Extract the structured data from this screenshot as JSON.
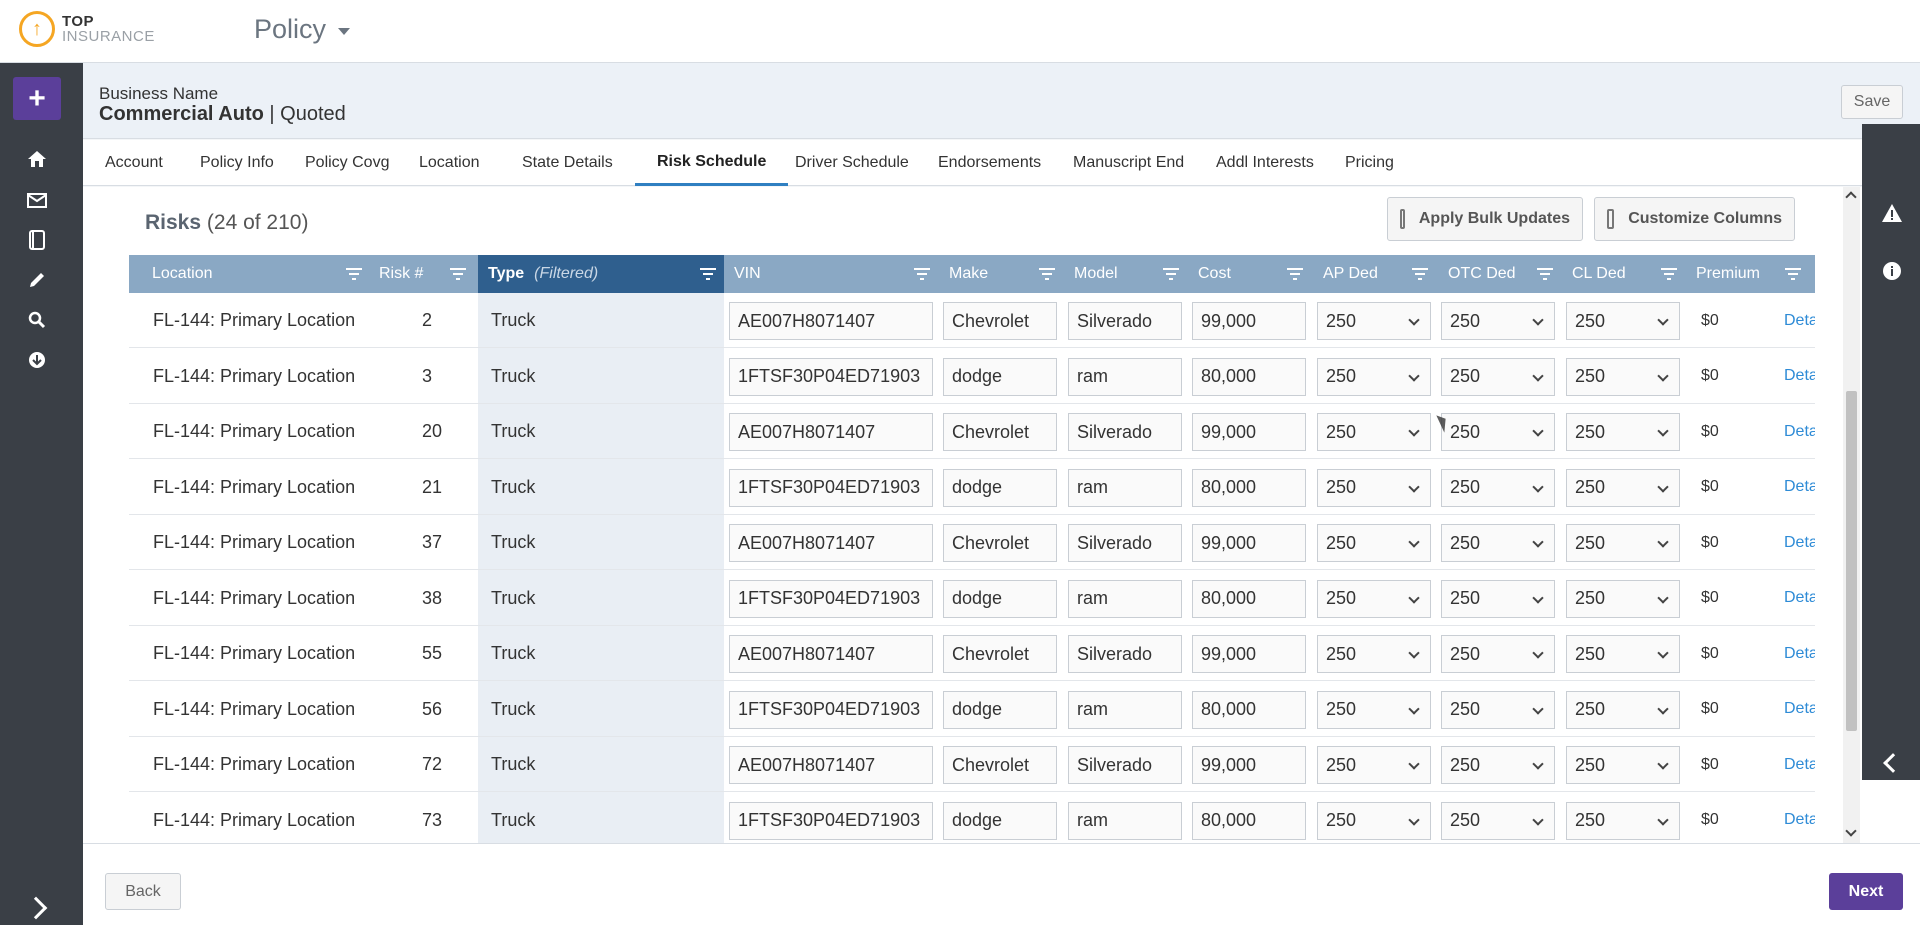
{
  "brand": {
    "top": "TOP",
    "bottom": "INSURANCE"
  },
  "app_menu": {
    "label": "Policy"
  },
  "header": {
    "business_name": "Business Name",
    "product": "Commercial Auto",
    "separator": " | ",
    "status": "Quoted",
    "save_label": "Save"
  },
  "tabs": [
    {
      "label": "Account"
    },
    {
      "label": "Policy Info"
    },
    {
      "label": "Policy Covg"
    },
    {
      "label": "Location"
    },
    {
      "label": "State Details"
    },
    {
      "label": "Risk Schedule",
      "active": true
    },
    {
      "label": "Driver Schedule"
    },
    {
      "label": "Endorsements"
    },
    {
      "label": "Manuscript End"
    },
    {
      "label": "Addl Interests"
    },
    {
      "label": "Pricing"
    }
  ],
  "risks": {
    "title": "Risks",
    "count": "(24 of 210)",
    "apply_bulk_label": "Apply Bulk Updates",
    "customize_label": "Customize Columns"
  },
  "columns": {
    "location": "Location",
    "risk": "Risk #",
    "type": "Type",
    "type_filtered": "(Filtered)",
    "vin": "VIN",
    "make": "Make",
    "model": "Model",
    "cost": "Cost",
    "ap_ded": "AP Ded",
    "otc_ded": "OTC Ded",
    "cl_ded": "CL Ded",
    "premium": "Premium"
  },
  "rows": [
    {
      "location": "FL-144: Primary Location",
      "risk": "2",
      "type": "Truck",
      "vin": "AE007H8071407",
      "make": "Chevrolet",
      "model": "Silverado",
      "cost": "99,000",
      "ap": "250",
      "otc": "250",
      "cl": "250",
      "premium": "$0",
      "detail": "Deta"
    },
    {
      "location": "FL-144: Primary Location",
      "risk": "3",
      "type": "Truck",
      "vin": "1FTSF30P04ED71903",
      "make": "dodge",
      "model": "ram",
      "cost": "80,000",
      "ap": "250",
      "otc": "250",
      "cl": "250",
      "premium": "$0",
      "detail": "Deta"
    },
    {
      "location": "FL-144: Primary Location",
      "risk": "20",
      "type": "Truck",
      "vin": "AE007H8071407",
      "make": "Chevrolet",
      "model": "Silverado",
      "cost": "99,000",
      "ap": "250",
      "otc": "250",
      "cl": "250",
      "premium": "$0",
      "detail": "Deta"
    },
    {
      "location": "FL-144: Primary Location",
      "risk": "21",
      "type": "Truck",
      "vin": "1FTSF30P04ED71903",
      "make": "dodge",
      "model": "ram",
      "cost": "80,000",
      "ap": "250",
      "otc": "250",
      "cl": "250",
      "premium": "$0",
      "detail": "Deta"
    },
    {
      "location": "FL-144: Primary Location",
      "risk": "37",
      "type": "Truck",
      "vin": "AE007H8071407",
      "make": "Chevrolet",
      "model": "Silverado",
      "cost": "99,000",
      "ap": "250",
      "otc": "250",
      "cl": "250",
      "premium": "$0",
      "detail": "Deta"
    },
    {
      "location": "FL-144: Primary Location",
      "risk": "38",
      "type": "Truck",
      "vin": "1FTSF30P04ED71903",
      "make": "dodge",
      "model": "ram",
      "cost": "80,000",
      "ap": "250",
      "otc": "250",
      "cl": "250",
      "premium": "$0",
      "detail": "Deta"
    },
    {
      "location": "FL-144: Primary Location",
      "risk": "55",
      "type": "Truck",
      "vin": "AE007H8071407",
      "make": "Chevrolet",
      "model": "Silverado",
      "cost": "99,000",
      "ap": "250",
      "otc": "250",
      "cl": "250",
      "premium": "$0",
      "detail": "Deta"
    },
    {
      "location": "FL-144: Primary Location",
      "risk": "56",
      "type": "Truck",
      "vin": "1FTSF30P04ED71903",
      "make": "dodge",
      "model": "ram",
      "cost": "80,000",
      "ap": "250",
      "otc": "250",
      "cl": "250",
      "premium": "$0",
      "detail": "Deta"
    },
    {
      "location": "FL-144: Primary Location",
      "risk": "72",
      "type": "Truck",
      "vin": "AE007H8071407",
      "make": "Chevrolet",
      "model": "Silverado",
      "cost": "99,000",
      "ap": "250",
      "otc": "250",
      "cl": "250",
      "premium": "$0",
      "detail": "Deta"
    },
    {
      "location": "FL-144: Primary Location",
      "risk": "73",
      "type": "Truck",
      "vin": "1FTSF30P04ED71903",
      "make": "dodge",
      "model": "ram",
      "cost": "80,000",
      "ap": "250",
      "otc": "250",
      "cl": "250",
      "premium": "$0",
      "detail": "Deta"
    }
  ],
  "footer": {
    "back_label": "Back",
    "next_label": "Next"
  },
  "colors": {
    "accent": "#5b3f9a",
    "nav_bg": "#3a3f46",
    "grid_header": "#8aa8c4",
    "filtered_header": "#2f5f8e",
    "link": "#2e8bd6",
    "tab_active": "#2f7fc1",
    "logo": "#f5a623"
  },
  "icons": {
    "nav": [
      "home-icon",
      "mail-icon",
      "document-icon",
      "pencil-icon",
      "search-icon",
      "download-icon"
    ],
    "rail": [
      "warning-icon",
      "info-icon"
    ]
  }
}
